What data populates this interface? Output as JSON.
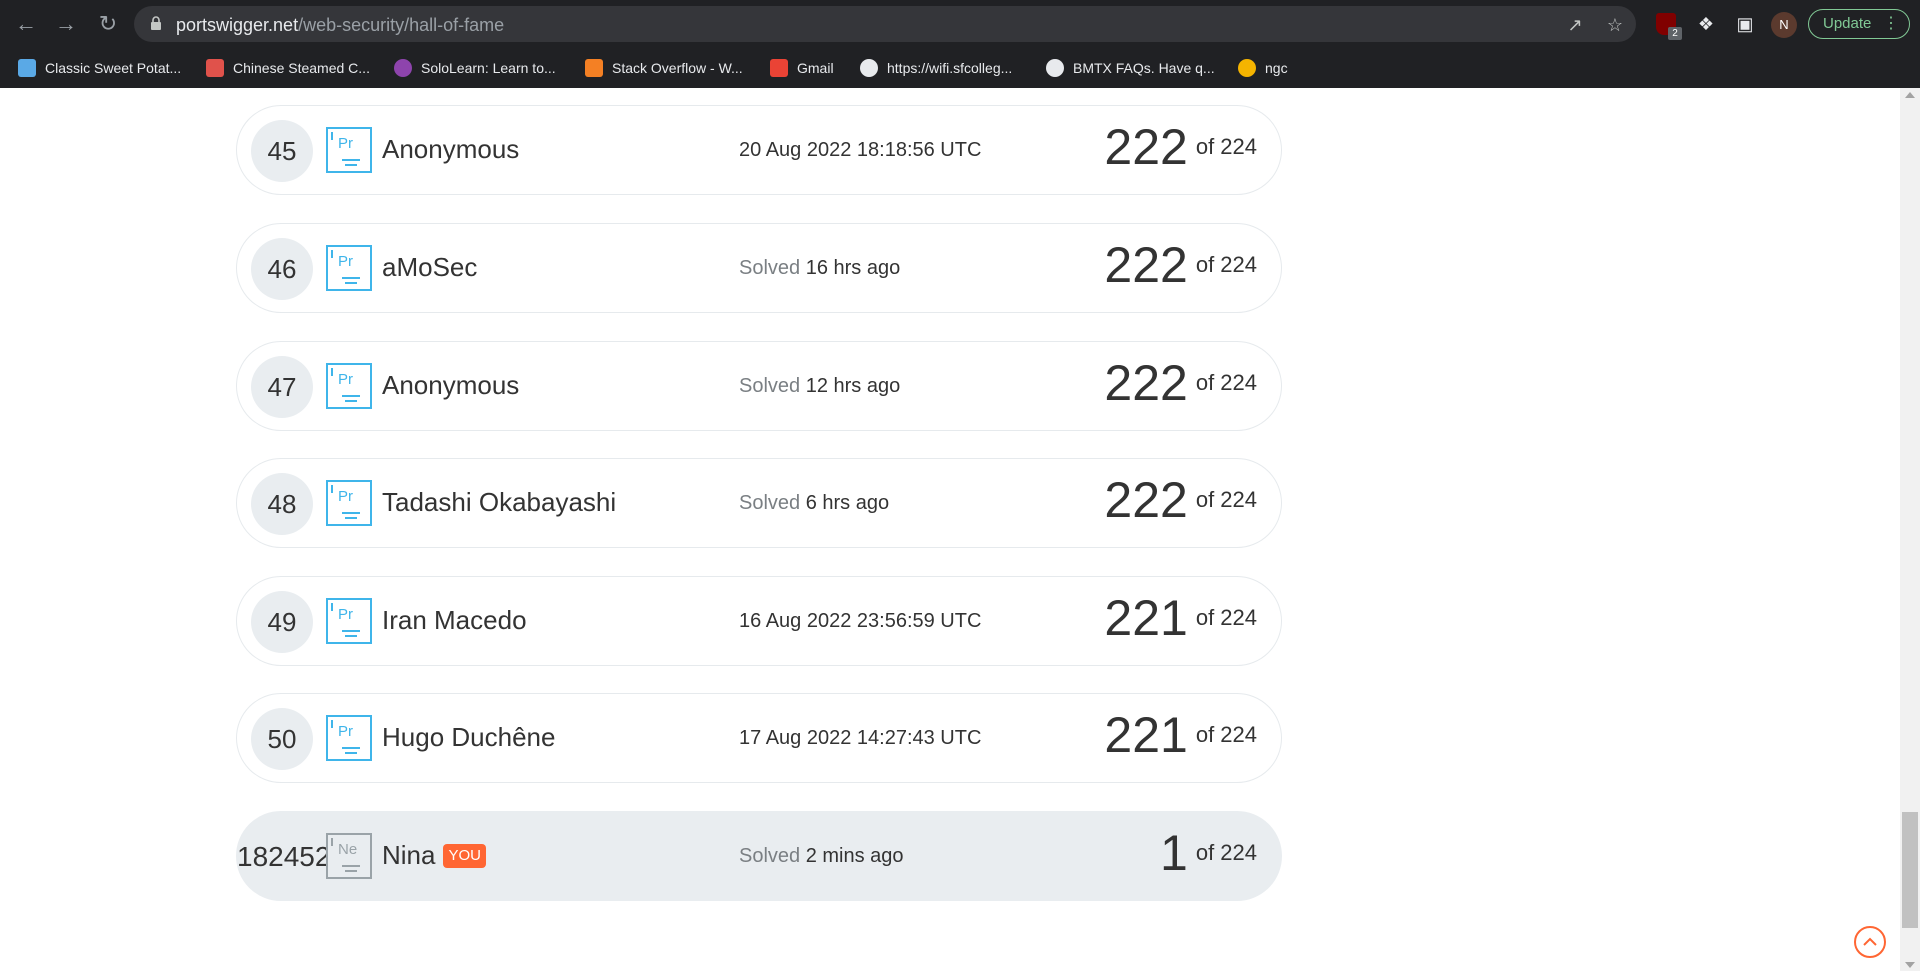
{
  "browser": {
    "url_host": "portswigger.net",
    "url_path": "/web-security/hall-of-fame",
    "extension_badge": "2",
    "profile_initial": "N",
    "update_label": "Update",
    "bookmarks": [
      {
        "label": "Classic Sweet Potat...",
        "icon": "utensils-icon",
        "color": "#5aa9e6"
      },
      {
        "label": "Chinese Steamed C...",
        "icon": "chef-icon",
        "color": "#e0524b"
      },
      {
        "label": "SoloLearn: Learn to...",
        "icon": "sololearn-icon",
        "color": "#8e44ad"
      },
      {
        "label": "Stack Overflow - W...",
        "icon": "stackoverflow-icon",
        "color": "#f48024"
      },
      {
        "label": "Gmail",
        "icon": "gmail-icon",
        "color": "#ea4335"
      },
      {
        "label": "https://wifi.sfcolleg...",
        "icon": "globe-icon",
        "color": "#e8eaed"
      },
      {
        "label": "BMTX FAQs. Have q...",
        "icon": "globe-icon",
        "color": "#e8eaed"
      },
      {
        "label": "ngc",
        "icon": "ngc-icon",
        "color": "#f5b400"
      }
    ]
  },
  "leaderboard": [
    {
      "rank": "45",
      "element": "Pr",
      "name": "Anonymous",
      "solved_prefix": "",
      "solved_time": "20 Aug 2022 18:18:56 UTC",
      "score": "222",
      "total": "of 224",
      "you": false
    },
    {
      "rank": "46",
      "element": "Pr",
      "name": "aMoSec",
      "solved_prefix": "Solved",
      "solved_time": "16 hrs ago",
      "score": "222",
      "total": "of 224",
      "you": false
    },
    {
      "rank": "47",
      "element": "Pr",
      "name": "Anonymous",
      "solved_prefix": "Solved",
      "solved_time": "12 hrs ago",
      "score": "222",
      "total": "of 224",
      "you": false
    },
    {
      "rank": "48",
      "element": "Pr",
      "name": "Tadashi Okabayashi",
      "solved_prefix": "Solved",
      "solved_time": "6 hrs ago",
      "score": "222",
      "total": "of 224",
      "you": false
    },
    {
      "rank": "49",
      "element": "Pr",
      "name": "Iran Macedo",
      "solved_prefix": "",
      "solved_time": "16 Aug 2022 23:56:59 UTC",
      "score": "221",
      "total": "of 224",
      "you": false
    },
    {
      "rank": "50",
      "element": "Pr",
      "name": "Hugo Duchêne",
      "solved_prefix": "",
      "solved_time": "17 Aug 2022 14:27:43 UTC",
      "score": "221",
      "total": "of 224",
      "you": false
    },
    {
      "rank": "182452",
      "element": "Ne",
      "name": "Nina",
      "you_label": "YOU",
      "solved_prefix": "Solved",
      "solved_time": "2 mins ago",
      "score": "1",
      "total": "of 224",
      "you": true
    }
  ],
  "colors": {
    "accent": "#ff6633",
    "badge": "#3fb5ea",
    "update": "#81c995"
  }
}
